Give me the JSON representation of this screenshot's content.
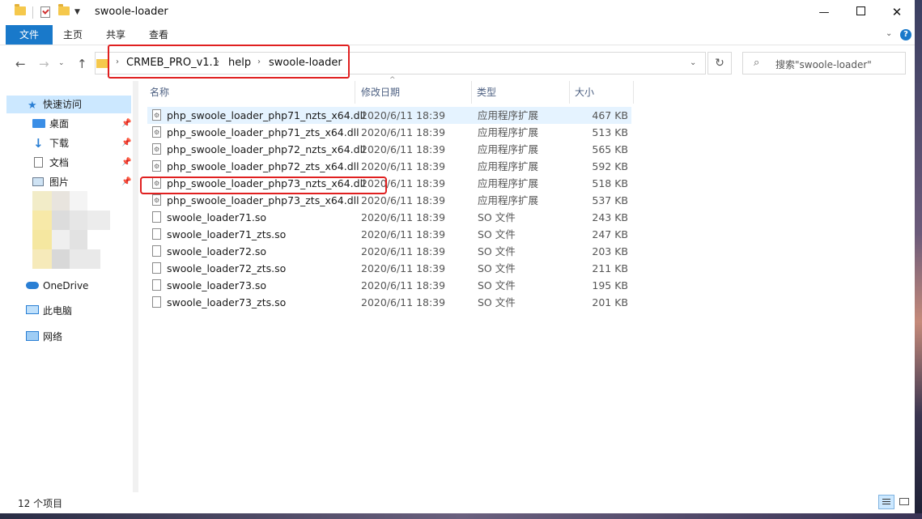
{
  "window": {
    "title": "swoole-loader",
    "controls": {
      "minimize": "—",
      "maximize": "",
      "close": "✕"
    }
  },
  "ribbon": {
    "tabs": [
      "文件",
      "主页",
      "共享",
      "查看"
    ],
    "expand_glyph": "⌄",
    "help_glyph": "?"
  },
  "address": {
    "breadcrumbs": [
      "CRMEB_PRO_v1.1",
      "help",
      "swoole-loader"
    ],
    "separator": "›",
    "refresh_glyph": "↻",
    "dropdown_glyph": "⌄"
  },
  "search": {
    "placeholder": "搜索\"swoole-loader\"",
    "icon_glyph": "⌕"
  },
  "nav_glyphs": {
    "back": "←",
    "forward": "→",
    "recent": "⌄",
    "up": "↑"
  },
  "navpane": {
    "quick_access": "快速访问",
    "pinned": [
      "桌面",
      "下载",
      "文档",
      "图片"
    ],
    "pin_glyph": "📌",
    "onedrive": "OneDrive",
    "this_pc": "此电脑",
    "network": "网络"
  },
  "columns": {
    "name": "名称",
    "date": "修改日期",
    "type": "类型",
    "size": "大小",
    "sort_glyph": "^"
  },
  "files": [
    {
      "name": "php_swoole_loader_php71_nzts_x64.dll",
      "date": "2020/6/11 18:39",
      "type": "应用程序扩展",
      "size": "467 KB",
      "icon": "dll-gear-icon"
    },
    {
      "name": "php_swoole_loader_php71_zts_x64.dll",
      "date": "2020/6/11 18:39",
      "type": "应用程序扩展",
      "size": "513 KB",
      "icon": "dll-gear-icon"
    },
    {
      "name": "php_swoole_loader_php72_nzts_x64.dll",
      "date": "2020/6/11 18:39",
      "type": "应用程序扩展",
      "size": "565 KB",
      "icon": "dll-gear-icon"
    },
    {
      "name": "php_swoole_loader_php72_zts_x64.dll",
      "date": "2020/6/11 18:39",
      "type": "应用程序扩展",
      "size": "592 KB",
      "icon": "dll-gear-icon"
    },
    {
      "name": "php_swoole_loader_php73_nzts_x64.dll",
      "date": "2020/6/11 18:39",
      "type": "应用程序扩展",
      "size": "518 KB",
      "icon": "dll-gear-icon"
    },
    {
      "name": "php_swoole_loader_php73_zts_x64.dll",
      "date": "2020/6/11 18:39",
      "type": "应用程序扩展",
      "size": "537 KB",
      "icon": "dll-gear-icon"
    },
    {
      "name": "swoole_loader71.so",
      "date": "2020/6/11 18:39",
      "type": "SO 文件",
      "size": "243 KB",
      "icon": "blank-file-icon"
    },
    {
      "name": "swoole_loader71_zts.so",
      "date": "2020/6/11 18:39",
      "type": "SO 文件",
      "size": "247 KB",
      "icon": "blank-file-icon"
    },
    {
      "name": "swoole_loader72.so",
      "date": "2020/6/11 18:39",
      "type": "SO 文件",
      "size": "203 KB",
      "icon": "blank-file-icon"
    },
    {
      "name": "swoole_loader72_zts.so",
      "date": "2020/6/11 18:39",
      "type": "SO 文件",
      "size": "211 KB",
      "icon": "blank-file-icon"
    },
    {
      "name": "swoole_loader73.so",
      "date": "2020/6/11 18:39",
      "type": "SO 文件",
      "size": "195 KB",
      "icon": "blank-file-icon"
    },
    {
      "name": "swoole_loader73_zts.so",
      "date": "2020/6/11 18:39",
      "type": "SO 文件",
      "size": "201 KB",
      "icon": "blank-file-icon"
    }
  ],
  "status": {
    "item_count": "12 个项目"
  },
  "colors": {
    "accent": "#1979ca",
    "highlight_border": "#e02020",
    "selection": "#cce8ff"
  }
}
